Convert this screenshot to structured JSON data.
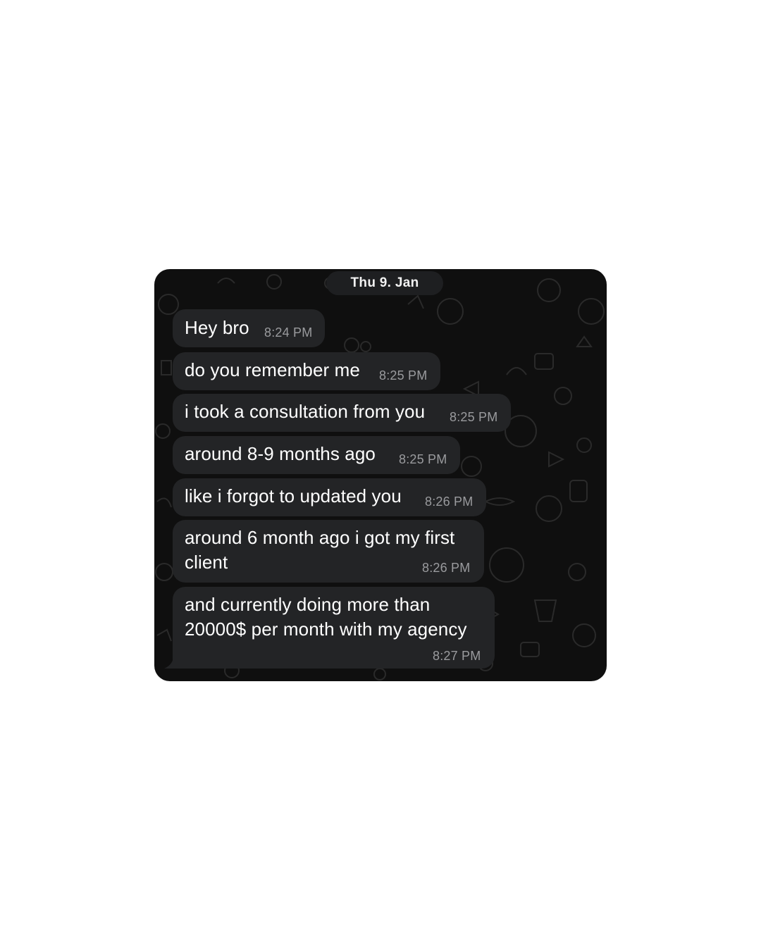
{
  "chat": {
    "date_label": "Thu 9. Jan",
    "messages": [
      {
        "text": "Hey bro",
        "time": "8:24 PM"
      },
      {
        "text": "do you remember me",
        "time": "8:25 PM"
      },
      {
        "text": "i took a consultation from you",
        "time": "8:25 PM"
      },
      {
        "text": "around 8-9 months ago",
        "time": "8:25 PM"
      },
      {
        "text": "like i forgot to updated you",
        "time": "8:26 PM"
      },
      {
        "text_line1": "around 6 month ago i got my first",
        "text_line2": "client",
        "time": "8:26 PM"
      },
      {
        "text_line1": "and currently doing more than",
        "text_line2": "20000$ per month with my agency",
        "time": "8:27 PM"
      }
    ]
  },
  "colors": {
    "background": "#0f0f0f",
    "bubble": "#232426",
    "timestamp": "#9a9b9e",
    "page": "#ffffff"
  },
  "icons": [
    "chat-wallpaper-doodle-pattern"
  ]
}
